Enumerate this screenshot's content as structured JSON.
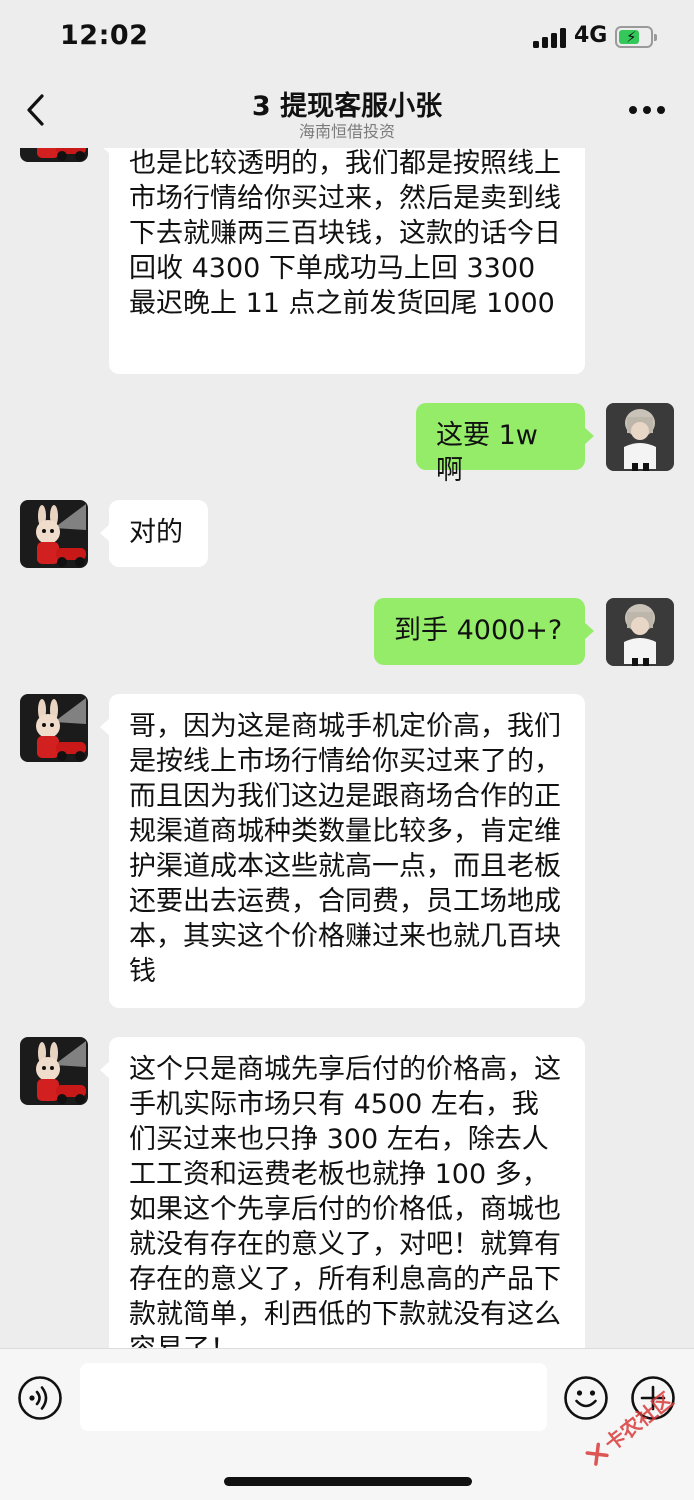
{
  "status_bar": {
    "time": "12:02",
    "network": "4G",
    "battery_color": "#34c759"
  },
  "header": {
    "title": "3 提现客服小张",
    "subtitle": "海南恒借投资",
    "back_icon": "chevron-left-icon",
    "more_icon": "more-dots-icon"
  },
  "messages": [
    {
      "from": "agent",
      "text": "也是比较透明的，我们都是按照线上市场行情给你买过来，然后是卖到线下去就赚两三百块钱，这款的话今日回收 4300 下单成功马上回 3300 最迟晚上 11 点之前发货回尾 1000"
    },
    {
      "from": "me",
      "text": "这要 1w 啊"
    },
    {
      "from": "agent",
      "text": "对的"
    },
    {
      "from": "me",
      "text": "到手 4000+?"
    },
    {
      "from": "agent",
      "text": "哥，因为这是商城手机定价高，我们是按线上市场行情给你买过来了的，而且因为我们这边是跟商场合作的正规渠道商城种类数量比较多，肯定维护渠道成本这些就高一点，而且老板还要出去运费，合同费，员工场地成本，其实这个价格赚过来也就几百块钱"
    },
    {
      "from": "agent",
      "text": "这个只是商城先享后付的价格高，这手机实际市场只有 4500 左右，我们买过来也只挣 300 左右，除去人工工资和运费老板也就挣 100 多，如果这个先享后付的价格低，商城也就没有存在的意义了，对吧！就算有存在的意义了，所有利息高的产品下款就简单，利西低的下款就没有这么容易了！"
    }
  ],
  "input_bar": {
    "voice_icon": "voice-icon",
    "input_value": "",
    "emoji_icon": "emoji-icon",
    "plus_icon": "plus-icon"
  },
  "watermark": {
    "text": "卡农社区",
    "color": "#d93b3b"
  },
  "colors": {
    "background": "#ededed",
    "outgoing_bubble": "#95ec69",
    "incoming_bubble": "#ffffff"
  }
}
